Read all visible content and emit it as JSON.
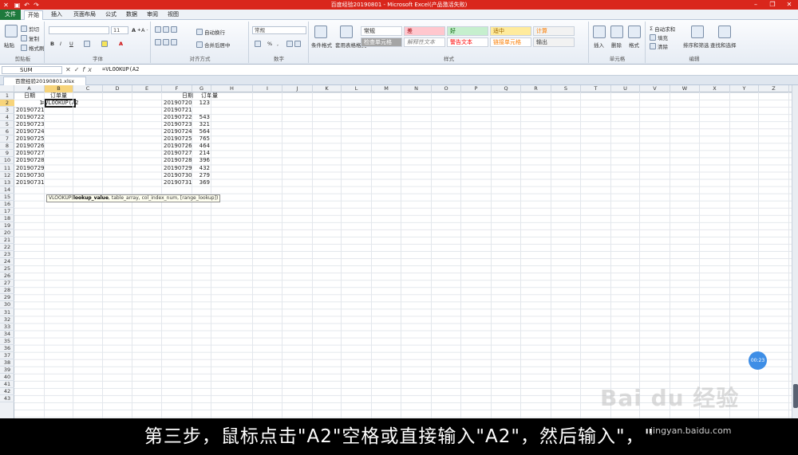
{
  "window": {
    "title": "百度经验20190801 - Microsoft Excel(产品激活失败)"
  },
  "ribbon_tabs": [
    "文件",
    "开始",
    "插入",
    "页面布局",
    "公式",
    "数据",
    "审阅",
    "视图"
  ],
  "ribbon": {
    "clipboard": {
      "cut": "剪切",
      "copy": "复制",
      "format_painter": "格式刷",
      "paste": "粘贴",
      "label": "剪贴板"
    },
    "font": {
      "size": "11",
      "label": "字体",
      "bold": "B",
      "italic": "I",
      "underline": "U"
    },
    "alignment": {
      "wrap": "自动换行",
      "merge": "合并后居中",
      "label": "对齐方式"
    },
    "number": {
      "format": "常规",
      "percent": "%",
      "comma": ",",
      "label": "数字"
    },
    "styles": {
      "conditional": "条件格式",
      "table": "套用表格格式",
      "label": "样式",
      "cells": [
        {
          "text": "常规",
          "bg": "#ffffff",
          "color": "#222222"
        },
        {
          "text": "差",
          "bg": "#ffc7ce",
          "color": "#9c0006"
        },
        {
          "text": "好",
          "bg": "#c6efce",
          "color": "#006100"
        },
        {
          "text": "适中",
          "bg": "#ffeb9c",
          "color": "#9c6500"
        },
        {
          "text": "计算",
          "bg": "#f2f2f2",
          "color": "#fa7d00"
        },
        {
          "text": "检查单元格",
          "bg": "#a5a5a5",
          "color": "#ffffff"
        },
        {
          "text": "解释性文本",
          "bg": "#ffffff",
          "color": "#7f7f7f"
        },
        {
          "text": "警告文本",
          "bg": "#ffffff",
          "color": "#ff0000"
        },
        {
          "text": "链接单元格",
          "bg": "#ffffff",
          "color": "#fa7d00"
        },
        {
          "text": "输出",
          "bg": "#f2f2f2",
          "color": "#3f3f3f"
        }
      ]
    },
    "cells": {
      "insert": "插入",
      "delete": "删除",
      "format": "格式",
      "label": "单元格"
    },
    "editing": {
      "autosum": "自动求和",
      "fill": "填充",
      "clear": "清除",
      "sort": "排序和筛选",
      "find": "查找和选择",
      "label": "编辑"
    }
  },
  "formula_bar": {
    "name_box": "SUM",
    "formula": "=VLOOKUP(A2"
  },
  "workbook": {
    "tab": "百度经验20190801.xlsx"
  },
  "grid": {
    "columns": [
      "A",
      "B",
      "C",
      "D",
      "E",
      "F",
      "G",
      "H",
      "I",
      "J",
      "K",
      "L",
      "M",
      "N",
      "O",
      "P",
      "Q",
      "R",
      "S",
      "T",
      "U",
      "V",
      "W",
      "X",
      "Y",
      "Z"
    ],
    "rows": [
      "1",
      "2",
      "3",
      "4",
      "5",
      "6",
      "7",
      "8",
      "9",
      "10",
      "11",
      "12",
      "13",
      "14",
      "15",
      "16",
      "17",
      "18",
      "19",
      "20",
      "21",
      "22",
      "23",
      "24",
      "25",
      "26",
      "27",
      "28",
      "29",
      "30",
      "31",
      "32",
      "33",
      "34",
      "35",
      "36",
      "37",
      "38",
      "39",
      "40",
      "41",
      "42",
      "43"
    ],
    "headers_left": {
      "a": "日期",
      "b": "订单量"
    },
    "headers_right": {
      "f": "日期",
      "g": "订单量"
    },
    "col_a": [
      "1",
      "20190721",
      "20190722",
      "20190723",
      "20190724",
      "20190725",
      "20190726",
      "20190727",
      "20190728",
      "20190729",
      "20190730",
      "20190731"
    ],
    "b2": "=VLOOKUP(A2",
    "col_f": [
      "20190720",
      "20190721",
      "20190722",
      "20190723",
      "20190724",
      "20190725",
      "20190726",
      "20190727",
      "20190728",
      "20190729",
      "20190730",
      "20190731"
    ],
    "col_g": [
      "123",
      "",
      "543",
      "321",
      "564",
      "765",
      "464",
      "214",
      "396",
      "432",
      "279",
      "369"
    ],
    "tooltip": {
      "fn": "VLOOKUP(",
      "arg1": "lookup_value",
      "rest": ", table_array, col_index_num, [range_lookup])"
    }
  },
  "timer": "00:23",
  "watermark": {
    "logo": "Bai du 经验",
    "url": "jingyan.baidu.com"
  },
  "subtitle": "第三步，鼠标点击\"A2\"空格或直接输入\"A2\"，然后输入\"，\""
}
